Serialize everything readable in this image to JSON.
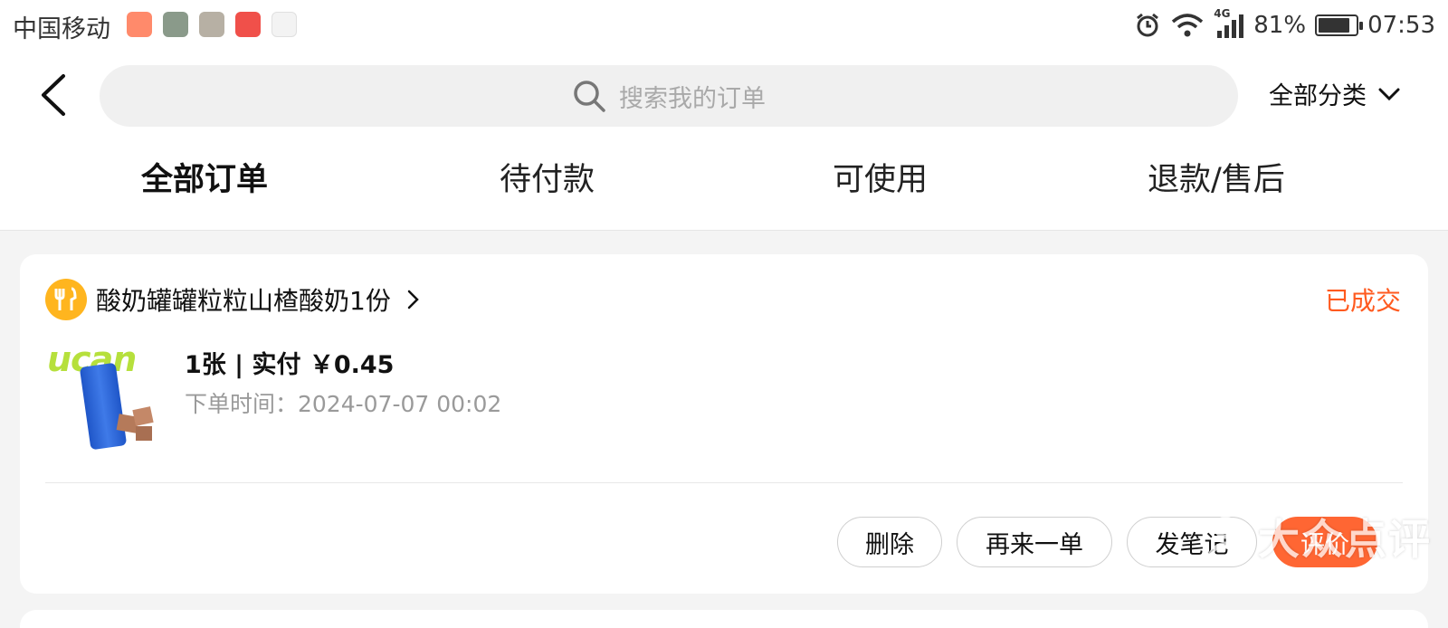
{
  "status_bar": {
    "carrier": "中国移动",
    "network": "4G",
    "battery": "81%",
    "time": "07:53"
  },
  "header": {
    "search_placeholder": "搜索我的订单",
    "category": "全部分类"
  },
  "tabs": [
    {
      "label": "全部订单",
      "active": true
    },
    {
      "label": "待付款",
      "active": false
    },
    {
      "label": "可使用",
      "active": false
    },
    {
      "label": "退款/售后",
      "active": false
    }
  ],
  "order": {
    "shop_name": "酸奶罐罐粒粒山楂酸奶1份",
    "status": "已成交",
    "summary": "1张 | 实付 ￥0.45",
    "time": "下单时间：2024-07-07 00:02",
    "thumb_brand": "ucan",
    "actions": {
      "delete": "删除",
      "reorder": "再来一单",
      "note": "发笔记",
      "review": "评价"
    }
  },
  "watermark": "大众点评",
  "colors": {
    "accent": "#ff6633",
    "status": "#ff5a1f",
    "shop_icon": "#ffb51f"
  }
}
